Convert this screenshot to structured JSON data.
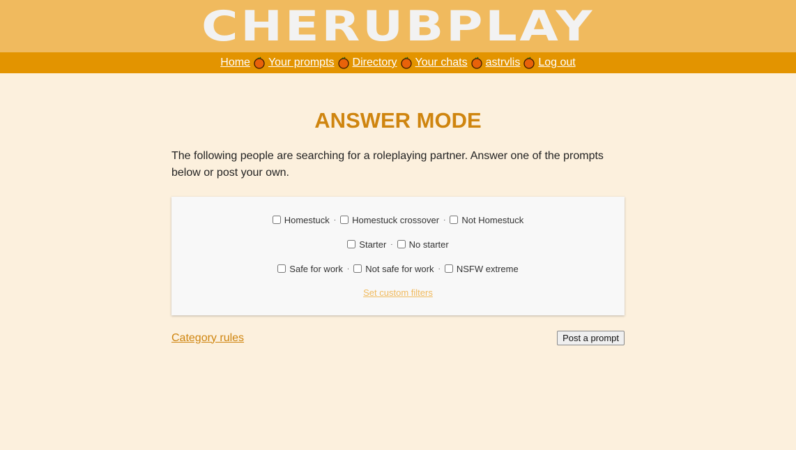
{
  "header": {
    "logo_text": "CHERUBPLAY"
  },
  "nav": {
    "items": [
      {
        "label": "Home"
      },
      {
        "label": "Your prompts"
      },
      {
        "label": "Directory"
      },
      {
        "label": "Your chats"
      },
      {
        "label": "astrvlis"
      },
      {
        "label": "Log out"
      }
    ],
    "separator_icon": "orange-icon"
  },
  "main": {
    "title": "ANSWER MODE",
    "intro": "The following people are searching for a roleplaying partner. Answer one of the prompts below or post your own."
  },
  "filters": {
    "rows": [
      [
        {
          "label": "Homestuck",
          "checked": false
        },
        {
          "label": "Homestuck crossover",
          "checked": false
        },
        {
          "label": "Not Homestuck",
          "checked": false
        }
      ],
      [
        {
          "label": "Starter",
          "checked": false
        },
        {
          "label": "No starter",
          "checked": false
        }
      ],
      [
        {
          "label": "Safe for work",
          "checked": false
        },
        {
          "label": "Not safe for work",
          "checked": false
        },
        {
          "label": "NSFW extreme",
          "checked": false
        }
      ]
    ],
    "separator": "·",
    "custom_filters_link": "Set custom filters"
  },
  "footer": {
    "category_rules": "Category rules",
    "post_prompt": "Post a prompt"
  },
  "colors": {
    "header_bg": "#f0ba5e",
    "nav_bg": "#e39400",
    "page_bg": "#fcf0dd",
    "title": "#cf850f",
    "link": "#cf850f",
    "custom_filters_link": "#f0ba5e"
  }
}
